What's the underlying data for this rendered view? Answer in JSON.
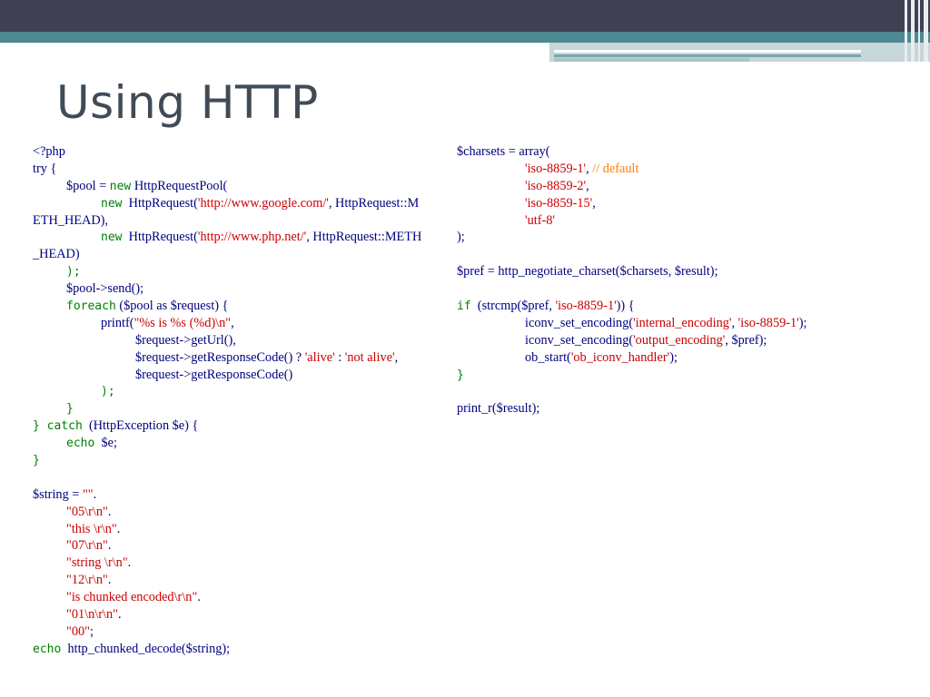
{
  "slide": {
    "title": "Using HTTP"
  },
  "code_left": {
    "lines": [
      {
        "t": "<?php"
      },
      {
        "t": "try {"
      },
      {
        "t": "$pool = new HttpRequestPool("
      },
      {
        "t": "new  HttpRequest('http://www.google.com/', HttpRequest::M"
      },
      {
        "t": "ETH_HEAD),"
      },
      {
        "t": "new  HttpRequest('http://www.php.net/', HttpRequest::METH"
      },
      {
        "t": "_HEAD)"
      },
      {
        "t": ");"
      },
      {
        "t": "$pool->send();"
      },
      {
        "t": "foreach ($pool as $request) {"
      },
      {
        "t": "printf(\"%s is %s (%d)\\n\","
      },
      {
        "t": "$request->getUrl(),"
      },
      {
        "t": "$request->getResponseCode() ? 'alive' : 'not alive',"
      },
      {
        "t": "$request->getResponseCode()"
      },
      {
        "t": ");"
      },
      {
        "t": "}"
      },
      {
        "t": "} catch  (HttpException $e) {"
      },
      {
        "t": "echo  $e;"
      },
      {
        "t": "}"
      },
      {
        "t": ""
      },
      {
        "t": "$string = \"\"."
      },
      {
        "t": "\"05\\r\\n\"."
      },
      {
        "t": "\"this \\r\\n\"."
      },
      {
        "t": "\"07\\r\\n\"."
      },
      {
        "t": "\"string \\r\\n\"."
      },
      {
        "t": "\"12\\r\\n\"."
      },
      {
        "t": "\"is chunked encoded\\r\\n\"."
      },
      {
        "t": "\"01\\n\\r\\n\"."
      },
      {
        "t": "\"00\";"
      },
      {
        "t": "echo  http_chunked_decode($string);"
      }
    ]
  },
  "code_right": {
    "lines": [
      {
        "t": "$charsets = array("
      },
      {
        "t": "'iso-8859-1', // default"
      },
      {
        "t": "'iso-8859-2',"
      },
      {
        "t": "'iso-8859-15',"
      },
      {
        "t": "'utf-8'"
      },
      {
        "t": ");"
      },
      {
        "t": ""
      },
      {
        "t": "$pref = http_negotiate_charset($charsets, $result);"
      },
      {
        "t": ""
      },
      {
        "t": "if  (strcmp($pref, 'iso-8859-1')) {"
      },
      {
        "t": "iconv_set_encoding('internal_encoding', 'iso-8859-1');"
      },
      {
        "t": "iconv_set_encoding('output_encoding', $pref);"
      },
      {
        "t": "ob_start('ob_iconv_handler');"
      },
      {
        "t": "}"
      },
      {
        "t": ""
      },
      {
        "t": "print_r($result);"
      }
    ]
  },
  "colors": {
    "default_code": "#000080",
    "string": "#cc0000",
    "keyword": "#007f00",
    "comment": "#ff8000",
    "title": "#404b58",
    "top_bar": "#3f4153",
    "accent_teal": "#4d8990"
  }
}
